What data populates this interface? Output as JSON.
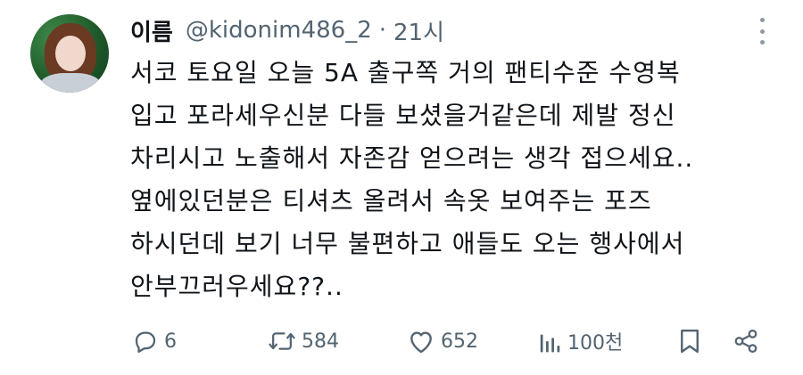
{
  "author": {
    "name": "이름",
    "handle": "@kidonim486_2",
    "separator": "·",
    "time": "21시"
  },
  "tweet": {
    "lines": [
      "서코 토요일 오늘 5A 출구쪽 거의 팬티수준 수영복",
      "입고 포라세우신분 다들 보셨을거같은데 제발 정신",
      "차리시고 노출해서 자존감 얻으려는 생각 접으세요..",
      "옆에있던분은 티셔츠 올려서 속옷 보여주는 포즈",
      "하시던데 보기 너무 불편하고 애들도 오는 행사에서",
      "안부끄러우세요??.."
    ]
  },
  "actions": {
    "reply_count": "6",
    "retweet_count": "584",
    "like_count": "652",
    "view_count": "100천"
  },
  "icons": {
    "more": "more-vertical-icon",
    "reply": "reply-icon",
    "retweet": "retweet-icon",
    "like": "heart-icon",
    "views": "views-chart-icon",
    "bookmark": "bookmark-icon",
    "share": "share-icon"
  },
  "colors": {
    "text": "#0f1419",
    "secondary": "#536471",
    "icon_gray": "#8b98a5"
  }
}
